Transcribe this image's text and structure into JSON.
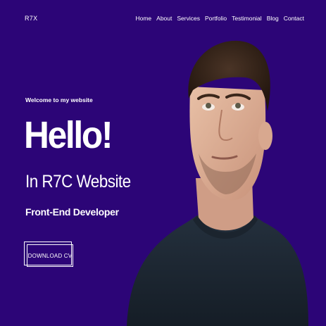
{
  "header": {
    "logo": "R7X",
    "nav": [
      {
        "label": "Home"
      },
      {
        "label": "About"
      },
      {
        "label": "Services"
      },
      {
        "label": "Portfolio"
      },
      {
        "label": "Testimonial"
      },
      {
        "label": "Blog"
      },
      {
        "label": "Contact"
      }
    ]
  },
  "hero": {
    "welcome": "Welcome to my website",
    "greeting": "Hello!",
    "subtitle": "In R7C Website",
    "role": "Front-End Developer",
    "cta_label": "DOWNLOAD CV"
  },
  "colors": {
    "background": "#2c0577",
    "text": "#ffffff"
  }
}
